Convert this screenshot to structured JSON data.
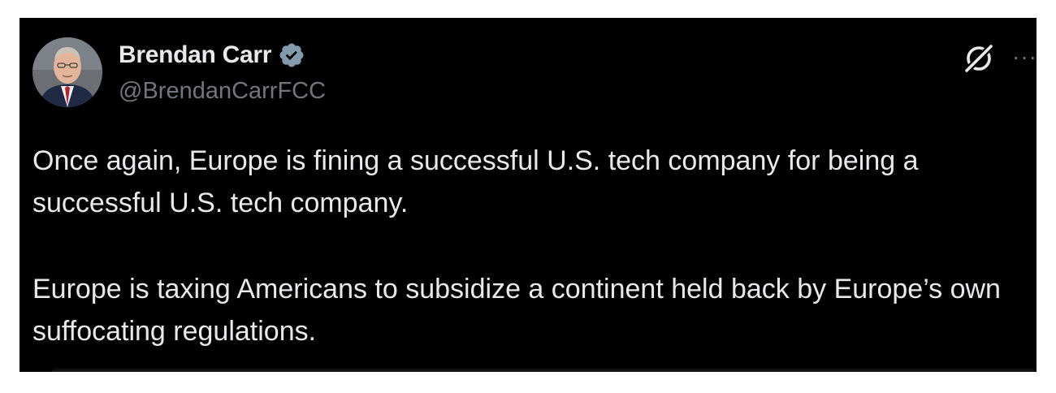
{
  "tweet": {
    "author": {
      "display_name": "Brendan Carr",
      "handle": "@BrendanCarrFCC",
      "verified_icon": "verified-badge-icon",
      "avatar_icon": "profile-photo"
    },
    "paragraphs": [
      "Once again, Europe is fining a successful U.S. tech company for being a successful U.S. tech company.",
      "Europe is taxing Americans to subsidize a continent held back by Europe’s own suffocating regulations."
    ],
    "actions": {
      "grok_icon": "grok-icon",
      "more_icon": "more-options-icon",
      "more_label": "···"
    }
  },
  "colors": {
    "background": "#000000",
    "text_primary": "#e7e9ea",
    "text_secondary": "#71767b",
    "verified_badge": "#829aab"
  }
}
